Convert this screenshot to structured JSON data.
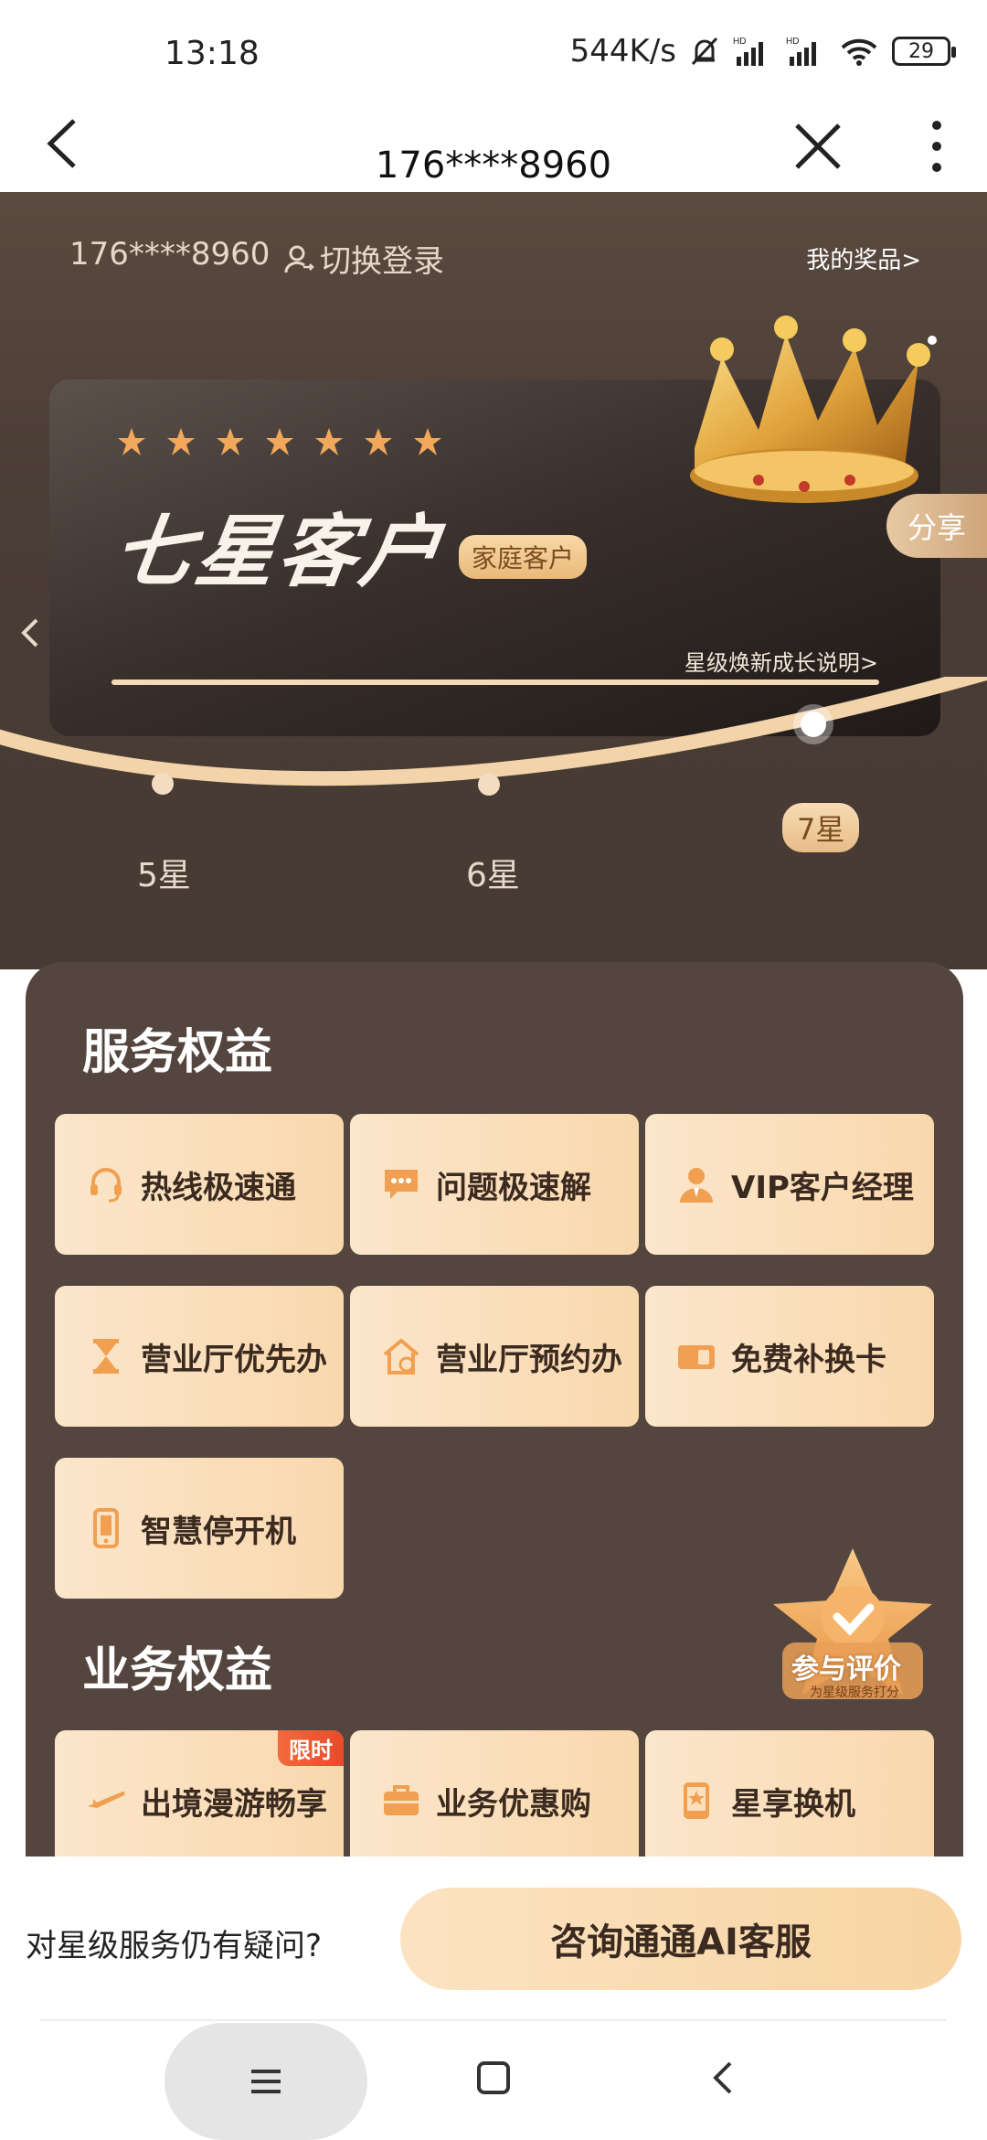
{
  "status_bar": {
    "time": "13:18",
    "network_speed": "544K/s",
    "battery": "29"
  },
  "title_bar": {
    "title": "176****8960"
  },
  "hero": {
    "account": "176****8960",
    "switch_login": "切换登录",
    "my_prizes": "我的奖品>",
    "share": "分享",
    "level_title": "七星客户",
    "star_count": 7,
    "family_badge": "家庭客户",
    "growth_link": "星级焕新成长说明>",
    "levels": [
      "5星",
      "6星",
      "7星"
    ],
    "current_level": "7星"
  },
  "service_rights": {
    "title": "服务权益",
    "items": [
      {
        "label": "热线极速通",
        "icon": "headset-icon"
      },
      {
        "label": "问题极速解",
        "icon": "chat-bubble-icon"
      },
      {
        "label": "VIP客户经理",
        "icon": "manager-icon"
      },
      {
        "label": "营业厅优先办",
        "icon": "hourglass-icon"
      },
      {
        "label": "营业厅预约办",
        "icon": "store-appointment-icon"
      },
      {
        "label": "免费补换卡",
        "icon": "sim-card-icon"
      },
      {
        "label": "智慧停开机",
        "icon": "phone-icon"
      }
    ]
  },
  "business_rights": {
    "title": "业务权益",
    "items": [
      {
        "label": "出境漫游畅享",
        "icon": "airplane-icon",
        "badge": "限时"
      },
      {
        "label": "业务优惠购",
        "icon": "briefcase-icon"
      },
      {
        "label": "星享换机",
        "icon": "star-phone-icon"
      }
    ]
  },
  "rate_widget": {
    "title": "参与评价",
    "subtitle": "为星级服务打分"
  },
  "bottom_bar": {
    "question": "对星级服务仍有疑问?",
    "ai_button": "咨询通通AI客服"
  },
  "colors": {
    "hero_bg": "#4a3d35",
    "panel_bg": "#54463f",
    "tile_bg": "#f9d8ad",
    "accent_orange": "#f0a050",
    "badge_red": "#e84b2a"
  }
}
